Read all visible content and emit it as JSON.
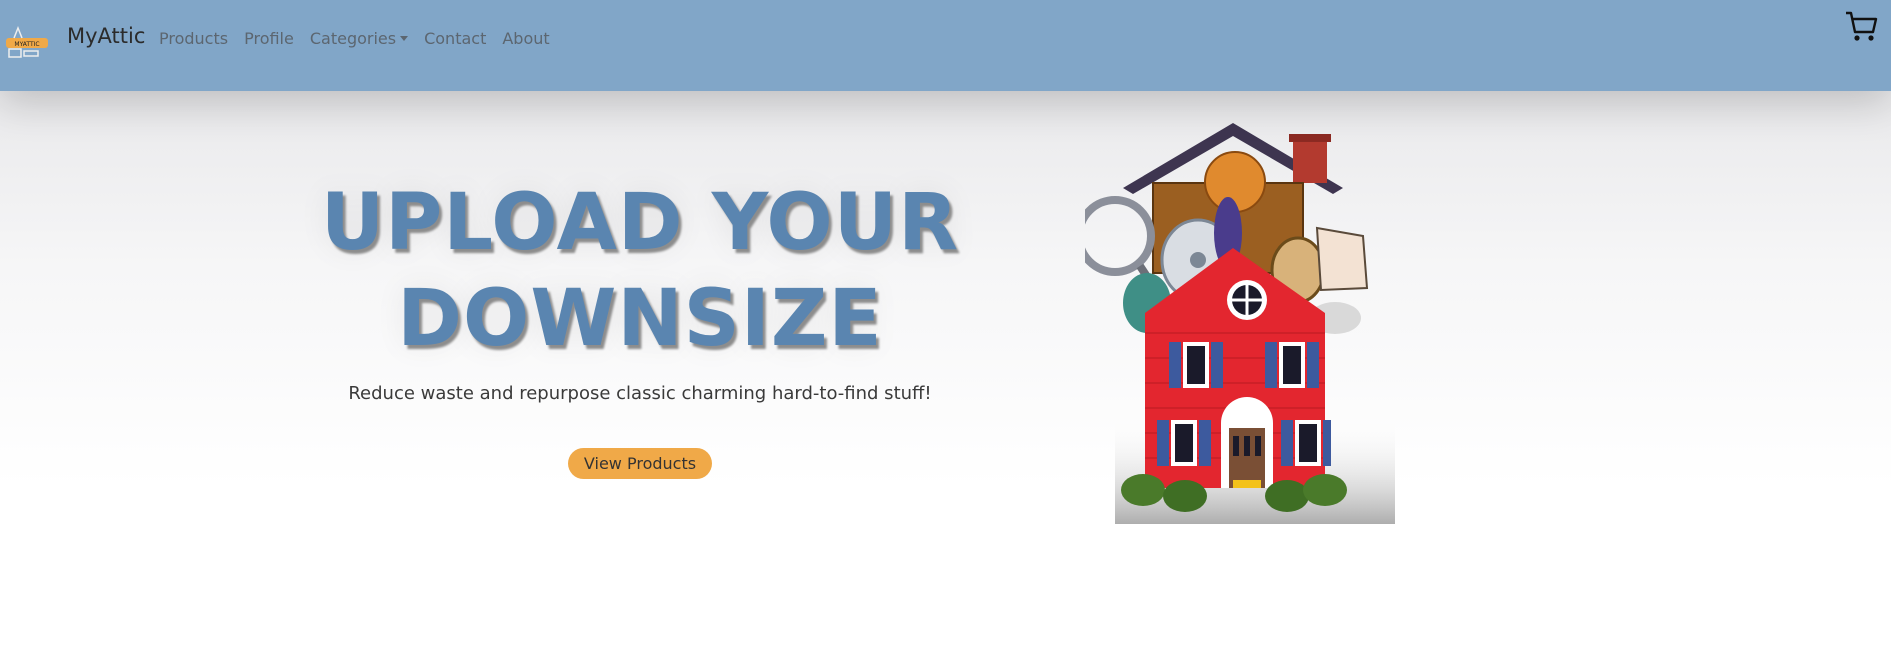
{
  "navbar": {
    "logo_text": "MYATTIC",
    "brand": "MyAttic",
    "links": [
      {
        "label": "Products"
      },
      {
        "label": "Profile"
      },
      {
        "label": "Categories"
      },
      {
        "label": "Contact"
      },
      {
        "label": "About"
      }
    ],
    "cart_icon": "shopping-cart-icon"
  },
  "hero": {
    "headline_line1": "UPLOAD YOUR",
    "headline_line2": "DOWNSIZE",
    "tagline": "Reduce waste and repurpose classic charming hard-to-find stuff!",
    "button_label": "View Products",
    "image_subject": "house-full-of-stuff-illustration"
  },
  "colors": {
    "navbar": "#81a6c8",
    "headline": "#5a85b0",
    "button": "#f0a948",
    "house_red": "#e3262f",
    "shutter_blue": "#3d5a9e"
  }
}
